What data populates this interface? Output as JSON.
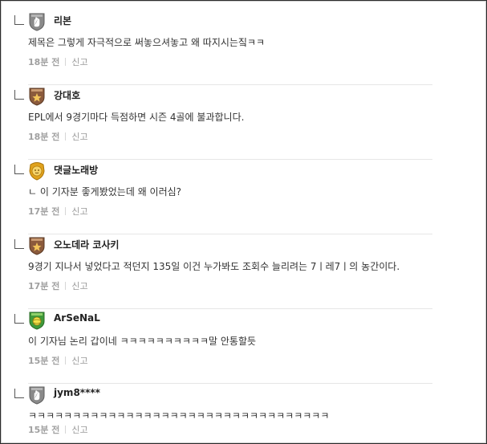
{
  "comments": [
    {
      "badge": "gray-shield-hand-icon",
      "nickname": "리본",
      "text": "제목은 그렇게 자극적으로 써놓으셔놓고 왜 따지시는짘ㅋㅋ",
      "time": "18분 전",
      "report": "신고"
    },
    {
      "badge": "brown-shield-star-icon",
      "nickname": "강대호",
      "text": "EPL에서 9경기마다 득점하면 시즌 4골에 불과합니다.",
      "time": "18분 전",
      "report": "신고"
    },
    {
      "badge": "gold-lion-emblem-icon",
      "nickname": "댓글노래방",
      "text": "ㄴ 이 기자분 좋게봤었는데 왜 이러심?",
      "time": "17분 전",
      "report": "신고"
    },
    {
      "badge": "brown-shield-star-icon",
      "nickname": "오노데라 코사키",
      "text": "9경기 지나서 넣었다고 적던지 135일 이건 누가봐도 조회수 늘리려는 7ㅣ레7ㅣ의 농간이다.",
      "time": "17분 전",
      "report": "신고"
    },
    {
      "badge": "green-shield-ball-icon",
      "nickname": "ArSeNaL",
      "text": "이 기자님 논리 갑이네 ㅋㅋㅋㅋㅋㅋㅋㅋㅋㅋ말 안통할듯",
      "time": "15분 전",
      "report": "신고"
    },
    {
      "badge": "gray-shield-hand-icon",
      "nickname": "jym8****",
      "text": "ㅋㅋㅋㅋㅋㅋㅋㅋㅋㅋㅋㅋㅋㅋㅋㅋㅋㅋㅋㅋㅋㅋㅋㅋㅋㅋㅋㅋㅋㅋㅋㅋㅋㅋ",
      "time": "15분 전",
      "report": "신고"
    }
  ],
  "colors": {
    "gray_badge": "#8a8a8a",
    "brown_badge": "#8b5a3c",
    "gold_badge": "#e0a21c",
    "green_badge": "#3f9a3a",
    "meta_text": "#999999"
  }
}
